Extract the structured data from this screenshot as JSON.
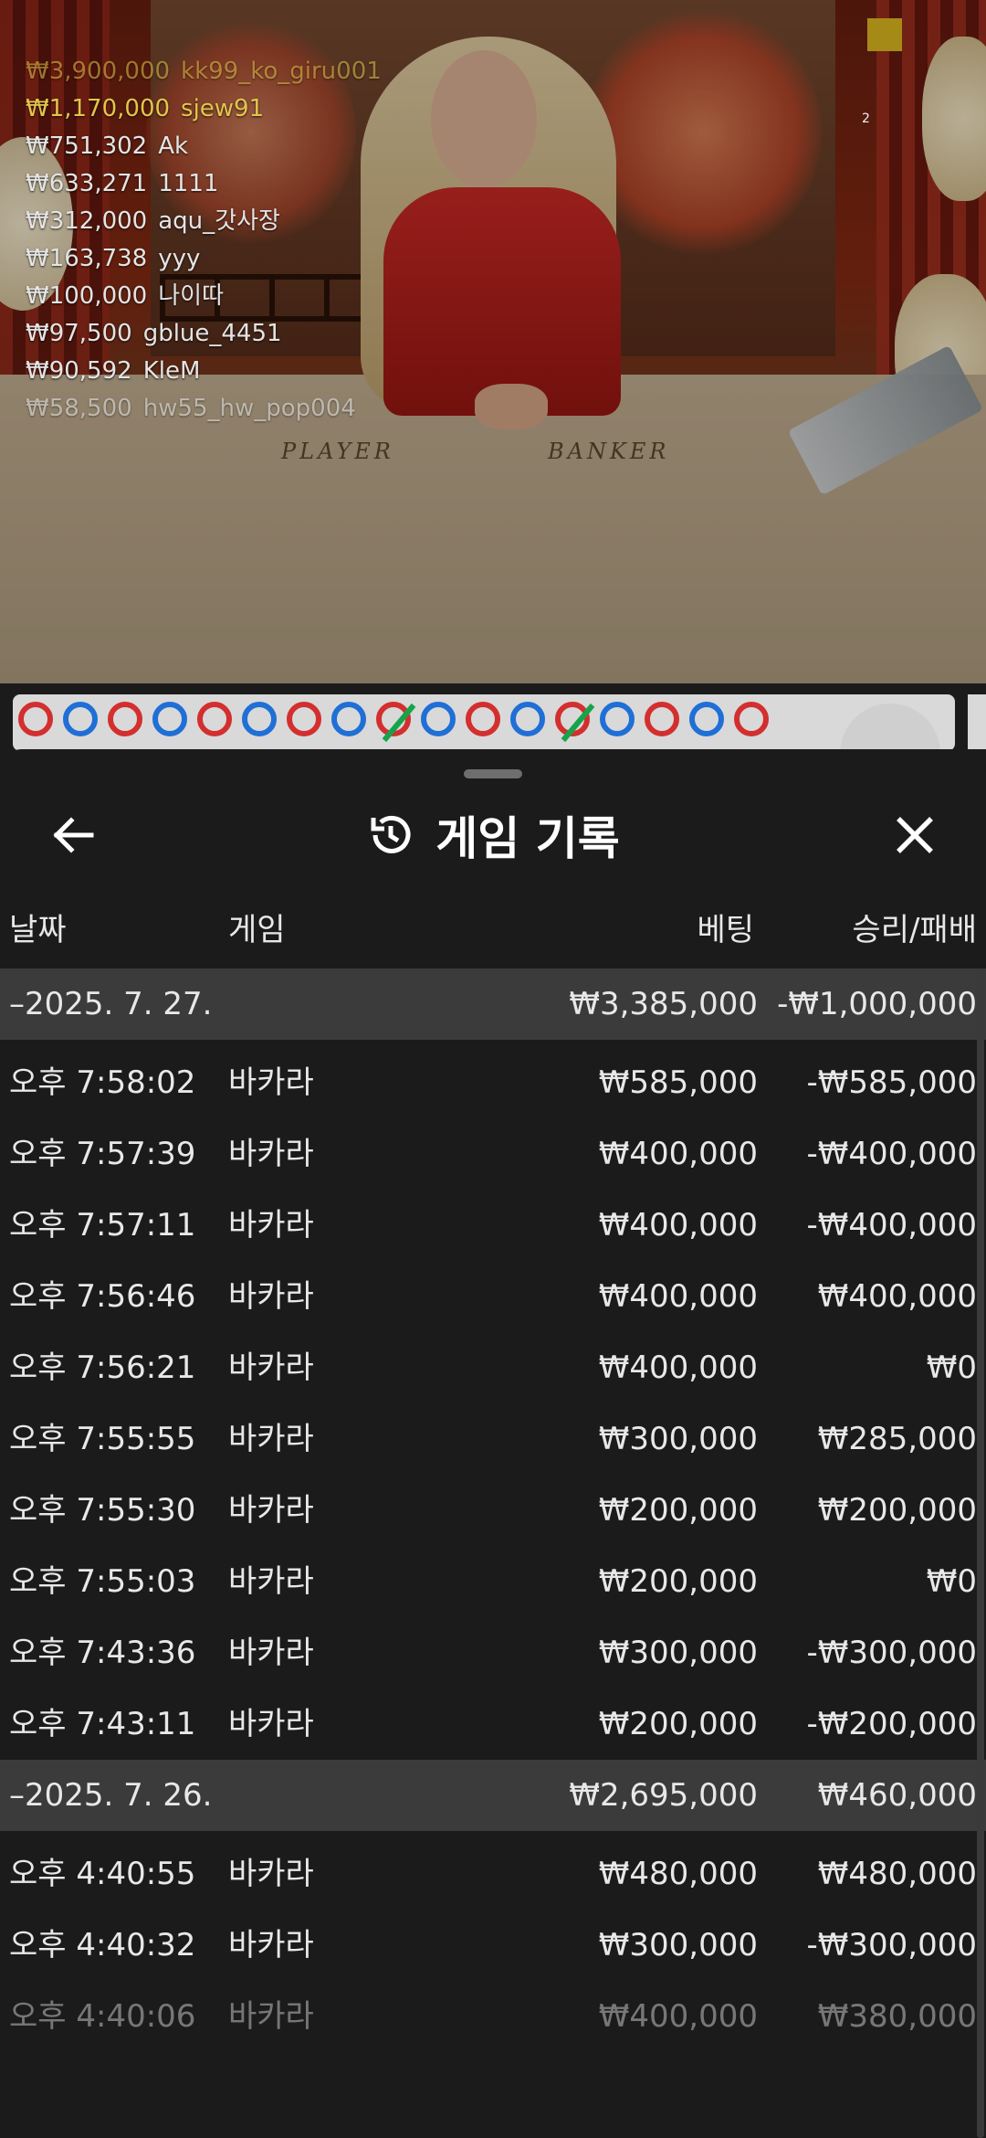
{
  "leaderboard": [
    {
      "amount": "₩3,900,000",
      "user": "kk99_ko_giru001"
    },
    {
      "amount": "₩1,170,000",
      "user": "sjew91"
    },
    {
      "amount": "₩751,302",
      "user": "Ak"
    },
    {
      "amount": "₩633,271",
      "user": "1111"
    },
    {
      "amount": "₩312,000",
      "user": "aqu_갓사장"
    },
    {
      "amount": "₩163,738",
      "user": "yyy"
    },
    {
      "amount": "₩100,000",
      "user": "나이따"
    },
    {
      "amount": "₩97,500",
      "user": "gblue_4451"
    },
    {
      "amount": "₩90,592",
      "user": "KleM"
    },
    {
      "amount": "₩58,500",
      "user": "hw55_hw_pop004"
    }
  ],
  "video": {
    "corner_number": "2",
    "table_labels": {
      "player": "PLAYER",
      "banker": "BANKER"
    }
  },
  "bead_road": {
    "colors": {
      "banker": "#d32f2f",
      "player": "#1f6fd6",
      "tie": "#16a34a"
    },
    "results": [
      "B",
      "P",
      "B",
      "P",
      "B",
      "P",
      "B",
      "P",
      "T",
      "P",
      "B",
      "P",
      "T",
      "P",
      "B",
      "P",
      "B"
    ]
  },
  "panel": {
    "title": "게임 기록",
    "title_icon": "history-icon",
    "back_icon": "arrow-left-icon",
    "close_icon": "close-icon"
  },
  "columns": {
    "date": "날짜",
    "game": "게임",
    "bet": "베팅",
    "result": "승리/패배"
  },
  "groups": [
    {
      "date": "–2025. 7. 27.",
      "bet_total": "₩3,385,000",
      "result_total": "-₩1,000,000",
      "rows": [
        {
          "time": "오후 7:58:02",
          "game": "바카라",
          "bet": "₩585,000",
          "result": "-₩585,000"
        },
        {
          "time": "오후 7:57:39",
          "game": "바카라",
          "bet": "₩400,000",
          "result": "-₩400,000"
        },
        {
          "time": "오후 7:57:11",
          "game": "바카라",
          "bet": "₩400,000",
          "result": "-₩400,000"
        },
        {
          "time": "오후 7:56:46",
          "game": "바카라",
          "bet": "₩400,000",
          "result": "₩400,000"
        },
        {
          "time": "오후 7:56:21",
          "game": "바카라",
          "bet": "₩400,000",
          "result": "₩0"
        },
        {
          "time": "오후 7:55:55",
          "game": "바카라",
          "bet": "₩300,000",
          "result": "₩285,000"
        },
        {
          "time": "오후 7:55:30",
          "game": "바카라",
          "bet": "₩200,000",
          "result": "₩200,000"
        },
        {
          "time": "오후 7:55:03",
          "game": "바카라",
          "bet": "₩200,000",
          "result": "₩0"
        },
        {
          "time": "오후 7:43:36",
          "game": "바카라",
          "bet": "₩300,000",
          "result": "-₩300,000"
        },
        {
          "time": "오후 7:43:11",
          "game": "바카라",
          "bet": "₩200,000",
          "result": "-₩200,000"
        }
      ]
    },
    {
      "date": "–2025. 7. 26.",
      "bet_total": "₩2,695,000",
      "result_total": "₩460,000",
      "rows": [
        {
          "time": "오후 4:40:55",
          "game": "바카라",
          "bet": "₩480,000",
          "result": "₩480,000"
        },
        {
          "time": "오후 4:40:32",
          "game": "바카라",
          "bet": "₩300,000",
          "result": "-₩300,000"
        },
        {
          "time": "오후 4:40:06",
          "game": "바카라",
          "bet": "₩400,000",
          "result": "₩380,000"
        }
      ]
    }
  ]
}
